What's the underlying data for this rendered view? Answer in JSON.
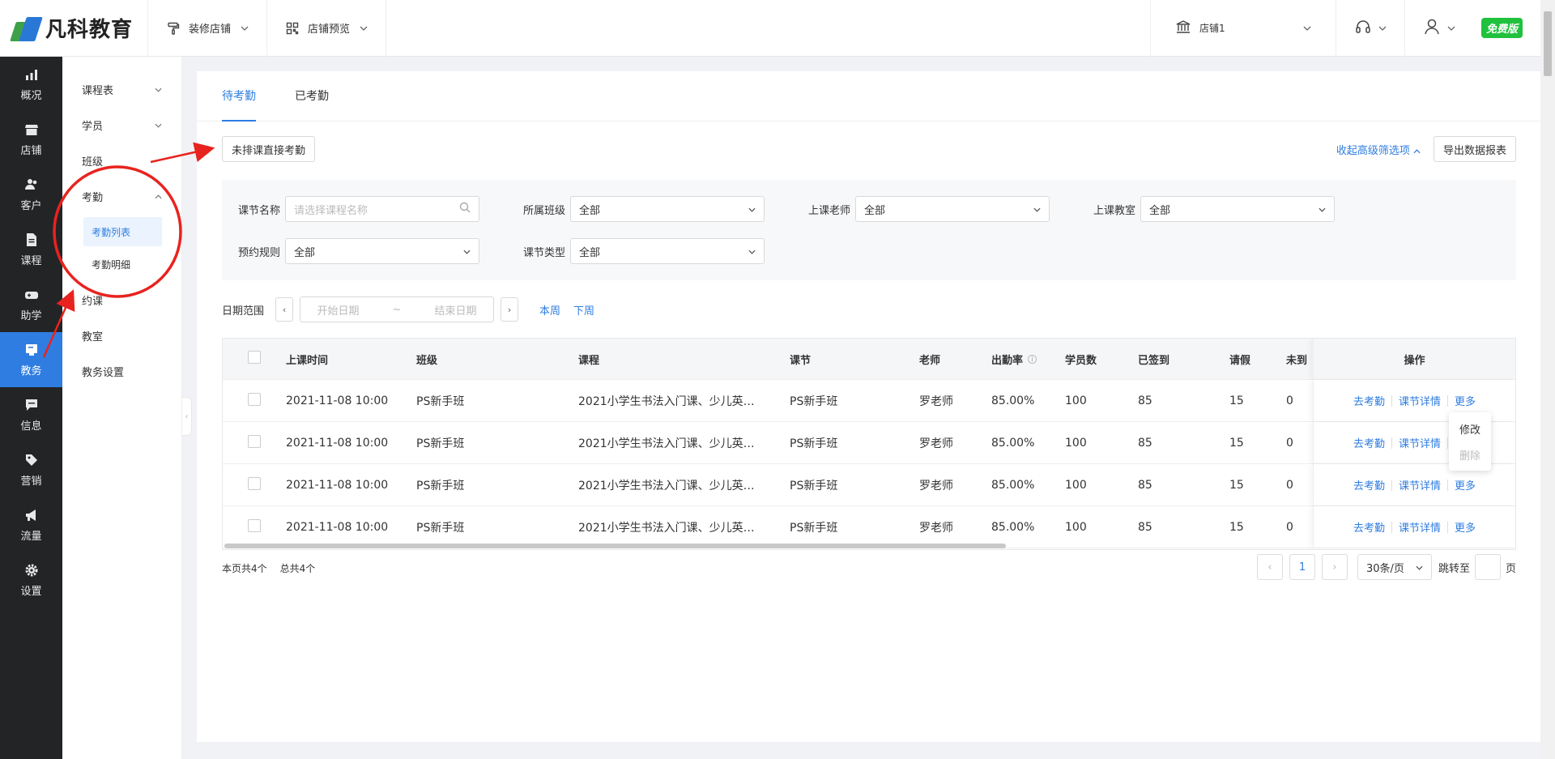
{
  "brand": {
    "name": "凡科教育"
  },
  "topbar": {
    "nav": [
      {
        "label": "装修店铺",
        "icon": "paint-roller-icon"
      },
      {
        "label": "店铺预览",
        "icon": "qrcode-icon"
      }
    ],
    "store": "店铺1",
    "badge": "免费版"
  },
  "leftnav": [
    {
      "label": "概况",
      "icon": "chart-icon"
    },
    {
      "label": "店铺",
      "icon": "shop-icon"
    },
    {
      "label": "客户",
      "icon": "users-icon"
    },
    {
      "label": "课程",
      "icon": "document-icon"
    },
    {
      "label": "助学",
      "icon": "gamepad-icon"
    },
    {
      "label": "教务",
      "icon": "board-icon",
      "active": true
    },
    {
      "label": "信息",
      "icon": "message-icon"
    },
    {
      "label": "营销",
      "icon": "tag-icon"
    },
    {
      "label": "流量",
      "icon": "megaphone-icon"
    },
    {
      "label": "设置",
      "icon": "gear-icon"
    }
  ],
  "submenu": {
    "schedule": "课程表",
    "students": "学员",
    "classes": "班级",
    "attendance": "考勤",
    "attendance_list": "考勤列表",
    "attendance_detail": "考勤明细",
    "booking": "约课",
    "classroom": "教室",
    "settings": "教务设置"
  },
  "tabs": [
    "待考勤",
    "已考勤"
  ],
  "toolbar": {
    "direct": "未排课直接考勤",
    "collapse": "收起高级筛选项",
    "export": "导出数据报表"
  },
  "filters": {
    "lesson_name": {
      "label": "课节名称",
      "placeholder": "请选择课程名称"
    },
    "class": {
      "label": "所属班级",
      "value": "全部"
    },
    "teacher": {
      "label": "上课老师",
      "value": "全部"
    },
    "room": {
      "label": "上课教室",
      "value": "全部"
    },
    "rule": {
      "label": "预约规则",
      "value": "全部"
    },
    "type": {
      "label": "课节类型",
      "value": "全部"
    }
  },
  "date": {
    "label": "日期范围",
    "start": "开始日期",
    "tilde": "~",
    "end": "结束日期",
    "this_week": "本周",
    "next_week": "下周"
  },
  "table": {
    "headers": [
      "上课时间",
      "班级",
      "课程",
      "课节",
      "老师",
      "出勤率",
      "学员数",
      "已签到",
      "请假",
      "未到",
      "操作"
    ],
    "rows": [
      {
        "time": "2021-11-08 10:00",
        "class": "PS新手班",
        "course": "2021小学生书法入门课、少儿英语...",
        "lesson": "PS新手班",
        "teacher": "罗老师",
        "rate": "85.00%",
        "students": "100",
        "signed": "85",
        "leave": "15",
        "absent": "0"
      },
      {
        "time": "2021-11-08 10:00",
        "class": "PS新手班",
        "course": "2021小学生书法入门课、少儿英语...",
        "lesson": "PS新手班",
        "teacher": "罗老师",
        "rate": "85.00%",
        "students": "100",
        "signed": "85",
        "leave": "15",
        "absent": "0"
      },
      {
        "time": "2021-11-08 10:00",
        "class": "PS新手班",
        "course": "2021小学生书法入门课、少儿英语...",
        "lesson": "PS新手班",
        "teacher": "罗老师",
        "rate": "85.00%",
        "students": "100",
        "signed": "85",
        "leave": "15",
        "absent": "0"
      },
      {
        "time": "2021-11-08 10:00",
        "class": "PS新手班",
        "course": "2021小学生书法入门课、少儿英语...",
        "lesson": "PS新手班",
        "teacher": "罗老师",
        "rate": "85.00%",
        "students": "100",
        "signed": "85",
        "leave": "15",
        "absent": "0"
      }
    ],
    "ops": {
      "attend": "去考勤",
      "detail": "课节详情",
      "more": "更多"
    },
    "info_icon": "i"
  },
  "dropdown": {
    "edit": "修改",
    "delete": "删除"
  },
  "footer": {
    "page_count": "本页共4个",
    "total": "总共4个",
    "current_page": "1",
    "page_size": "30条/页",
    "jump_to": "跳转至",
    "page_unit": "页"
  },
  "colors": {
    "accent": "#2f7de1",
    "nav_bg": "#232426",
    "badge": "#1fc13d",
    "annotation": "#e8231f"
  }
}
